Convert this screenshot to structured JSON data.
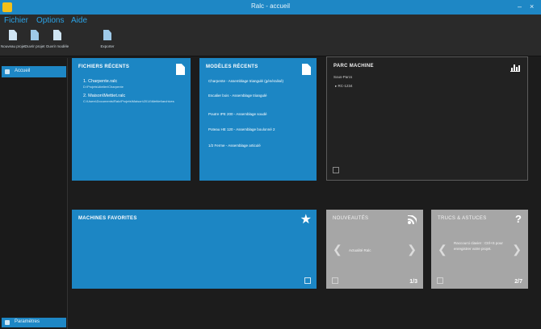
{
  "window": {
    "title": "Ralc - accueil",
    "minimize": "–",
    "close": "×"
  },
  "menu": [
    "Fichier",
    "Options",
    "Aide"
  ],
  "toolbar": [
    {
      "label": "Nouveau projet",
      "icon": "new-document-icon"
    },
    {
      "label": "Ouvrir projet",
      "icon": "open-document-icon"
    },
    {
      "label": "Ouvrir modèle",
      "icon": "open-template-icon"
    },
    {
      "label": "Exporter",
      "icon": "export-icon"
    }
  ],
  "sidebar": {
    "items": [
      {
        "label": "Accueil",
        "icon": "home-icon"
      }
    ],
    "bottom": {
      "label": "Paramètres",
      "icon": "settings-icon"
    }
  },
  "tiles": {
    "recent_files": {
      "title": "FICHIERS RÉCENTS",
      "items": [
        {
          "name": "1. Charpente.ralc",
          "path": "D:\\Projets\\Atelier\\Charpente"
        },
        {
          "name": "2. Maison\\Mettiet.ralc",
          "path": "C:\\Users\\Documents\\Ralc\\Projets\\Maison\\2014\\Mettiet\\archives"
        }
      ]
    },
    "recent_models": {
      "title": "MODÈLES RÉCENTS",
      "items": [
        "Charpente - Assemblage triangulé (généralisé)",
        "Escalier bois - Assemblage triangulé",
        "Poutre IPE 200 - Assemblage soudé",
        "Poteau HE 120 - Assemblage boulonné 2",
        "1/2 Ferme - Assemblage articulé"
      ]
    },
    "machine_park": {
      "title": "PARC MACHINE",
      "subtitle": "Sous-Parcs",
      "items": [
        "▸ RC-1234"
      ]
    },
    "favorite_machines": {
      "title": "MACHINES FAVORITES"
    },
    "news": {
      "title": "NOUVEAUTÉS",
      "text": "Actualité Ralc",
      "pager": "1/3",
      "prev": "❮",
      "next": "❯"
    },
    "tips": {
      "title": "TRUCS & ASTUCES",
      "text": "Raccourci clavier : Ctrl+S pour enregistrer votre projet.",
      "pager": "2/7",
      "prev": "❮",
      "next": "❯",
      "help": "?"
    }
  },
  "colors": {
    "accent": "#1e87c5",
    "tile_blue": "#1c86c4",
    "tile_gray": "#a6a6a6",
    "background": "#1c1c1c"
  }
}
